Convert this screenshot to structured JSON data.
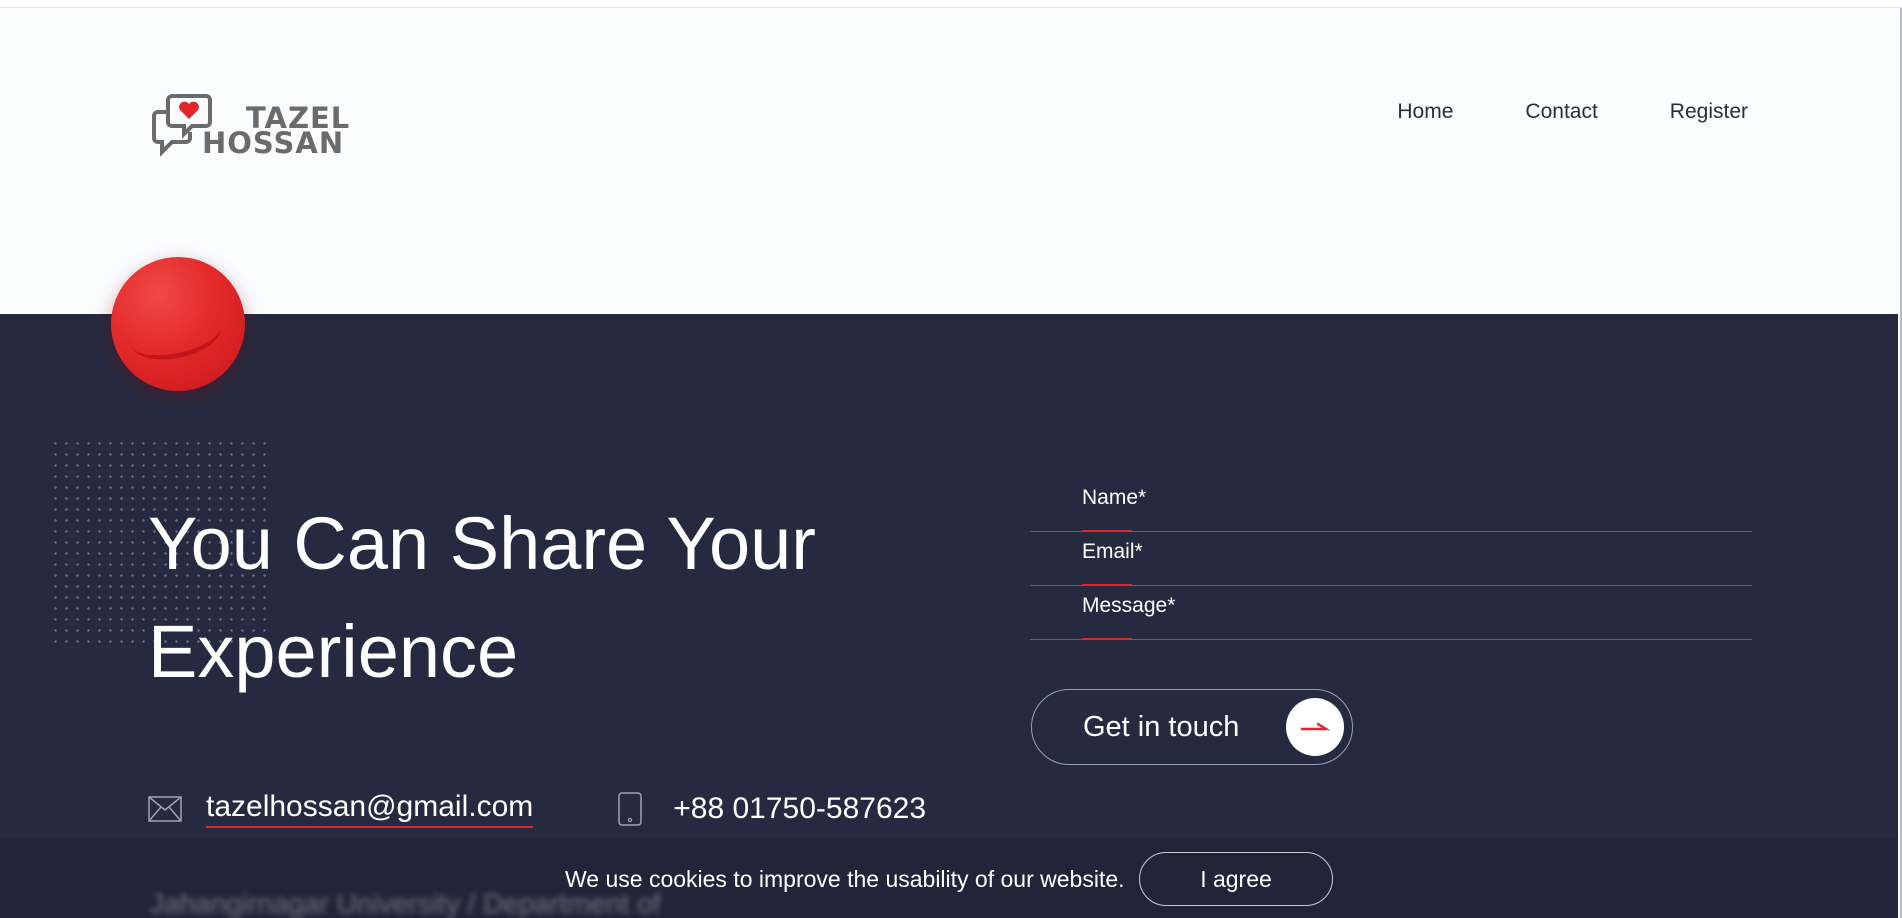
{
  "logo": {
    "line1": "TAZEL",
    "line2": "HOSSAN"
  },
  "nav": {
    "home": "Home",
    "contact": "Contact",
    "register": "Register"
  },
  "hero": {
    "headline": "You Can Share Your Experience"
  },
  "contact": {
    "email": "tazelhossan@gmail.com",
    "phone": "+88 01750-587623",
    "address_partial": "Jahangirnagar University / Department of"
  },
  "form": {
    "name_label": "Name*",
    "email_label": "Email*",
    "message_label": "Message*",
    "submit_label": "Get in touch"
  },
  "cookie": {
    "message": "We use cookies to improve the usability of our website.",
    "agree_label": "I agree"
  },
  "colors": {
    "accent": "#e0252b",
    "dark_bg": "#262a40",
    "light_bg": "#fbfcfe"
  }
}
